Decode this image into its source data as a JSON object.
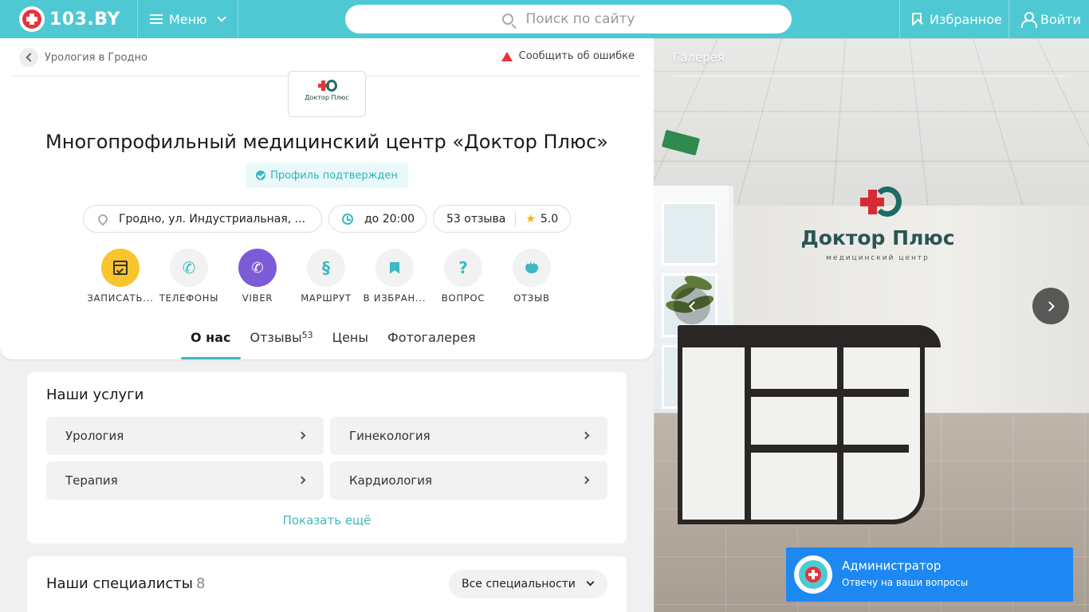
{
  "header": {
    "brand": "103.BY",
    "menu_label": "Меню",
    "search_placeholder": "Поиск по сайту",
    "favorites_label": "Избранное",
    "login_label": "Войти"
  },
  "breadcrumb": {
    "back_label": "Урологія в Гродно",
    "text": "Урология в Гродно"
  },
  "report_label": "Сообщить об ошибке",
  "org": {
    "logo_text": "Доктор Плюс",
    "title": "Многопрофильный медицинский центр «Доктор Плюс»",
    "verified_label": "Профиль подтвержден",
    "address": "Гродно, ул. Индустриальная, ...",
    "hours": "до 20:00",
    "reviews": "53 отзыва",
    "rating": "5.0"
  },
  "actions": [
    {
      "label": "ЗАПИСАТЬ...",
      "icon": "calendar-icon"
    },
    {
      "label": "ТЕЛЕФОНЫ",
      "icon": "phone-icon"
    },
    {
      "label": "VIBER",
      "icon": "viber-icon"
    },
    {
      "label": "МАРШРУТ",
      "icon": "route-icon"
    },
    {
      "label": "В ИЗБРАН...",
      "icon": "bookmark-icon"
    },
    {
      "label": "ВОПРОС",
      "icon": "question-icon"
    },
    {
      "label": "ОТЗЫВ",
      "icon": "chat-icon"
    }
  ],
  "tabs": [
    {
      "label": "О нас",
      "active": true
    },
    {
      "label": "Отзывы",
      "badge": "53"
    },
    {
      "label": "Цены"
    },
    {
      "label": "Фотогалерея"
    }
  ],
  "services": {
    "title": "Наши услуги",
    "items": [
      "Урология",
      "Гинекология",
      "Терапия",
      "Кардиология"
    ],
    "more_label": "Показать ещё"
  },
  "specialists": {
    "title": "Наши специалисты",
    "count": "8",
    "filter_value": "Все специальности"
  },
  "gallery": {
    "title": "Галерея",
    "photo_brand": "Доктор Плюс",
    "photo_sub": "медицинский центр"
  },
  "chat": {
    "name": "Администратор",
    "subtitle": "Отвечу на ваши вопросы"
  },
  "colors": {
    "accent": "#4ec9d3",
    "brand_red": "#e8323c",
    "viber": "#7c5cd6",
    "calendar": "#f9c52d",
    "chat_widget": "#1e88f2"
  }
}
